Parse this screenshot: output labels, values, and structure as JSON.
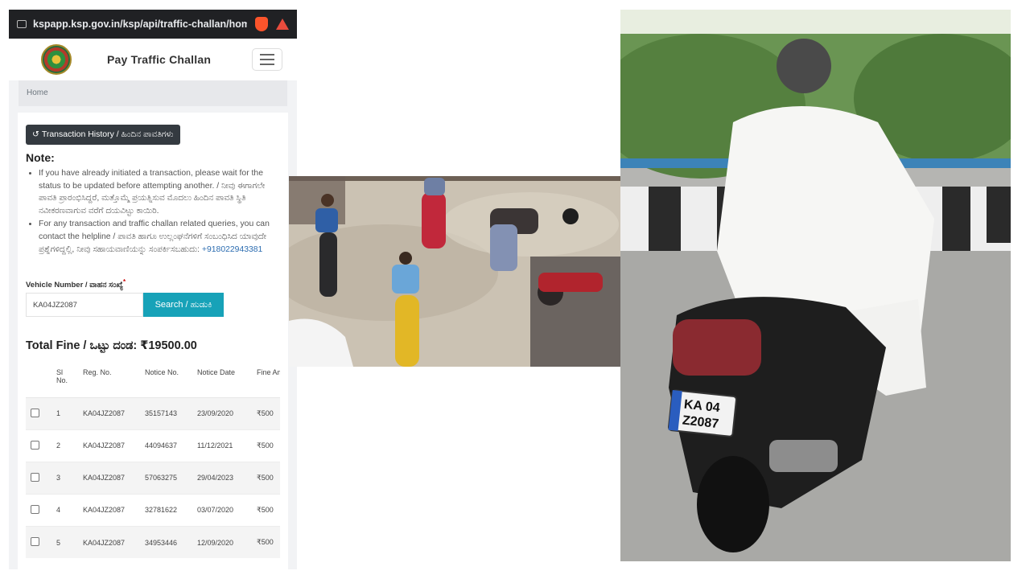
{
  "browser": {
    "url": "kspapp.ksp.gov.in/ksp/api/traffic-challan/hom"
  },
  "app": {
    "title": "Pay Traffic Challan",
    "breadcrumb": "Home"
  },
  "history_button": "Transaction History / ಹಿಂದಿನ ಪಾವತಿಗಳು",
  "note": {
    "title": "Note:",
    "items": [
      "If you have already initiated a transaction, please wait for the status to be updated before attempting another. / ನೀವು ಈಗಾಗಲೇ ಪಾವತಿ ಪ್ರಾರಂಭಿಸಿದ್ದರೆ, ಮತ್ತೊಮ್ಮೆ ಪ್ರಯತ್ನಿಸುವ ಮೊದಲು ಹಿಂದಿನ ಪಾವತಿ ಸ್ಥಿತಿ ನವೀಕರಣವಾಗುವ ವರೆಗೆ ದಯವಿಟ್ಟು ಕಾಯಿರಿ.",
      "For any transaction and traffic challan related queries, you can contact the helpline / ಪಾವತಿ ಹಾಗೂ ಉಲ್ಲಂಘನೆಗಳಿಗೆ ಸಂಬಂಧಿಸಿದ ಯಾವುದೇ ಪ್ರಶ್ನೆಗಳಿದ್ದಲ್ಲಿ, ನೀವು ಸಹಾಯವಾಣಿಯನ್ನು ಸಂಪರ್ಕಿಸಬಹುದು:"
    ],
    "helpline": "+918022943381"
  },
  "search": {
    "label": "Vehicle Number / ವಾಹನ ಸಂಖ್ಯೆ",
    "required_mark": "*",
    "value": "KA04JZ2087",
    "button": "Search / ಹುಡುಕಿ"
  },
  "total_fine": "Total Fine / ಒಟ್ಟು ದಂಡ: ₹19500.00",
  "table": {
    "headers": [
      "",
      "Sl No.",
      "Reg. No.",
      "Notice No.",
      "Notice Date",
      "Fine Amou"
    ],
    "rows": [
      [
        "1",
        "KA04JZ2087",
        "35157143",
        "23/09/2020",
        "₹500"
      ],
      [
        "2",
        "KA04JZ2087",
        "44094637",
        "11/12/2021",
        "₹500"
      ],
      [
        "3",
        "KA04JZ2087",
        "57063275",
        "29/04/2023",
        "₹500"
      ],
      [
        "4",
        "KA04JZ2087",
        "32781622",
        "03/07/2020",
        "₹500"
      ],
      [
        "5",
        "KA04JZ2087",
        "34953446",
        "12/09/2020",
        "₹500"
      ]
    ]
  },
  "photo_right": {
    "plate_line1": "KA 04",
    "plate_line2": "Z2087"
  },
  "colors": {
    "search_button": "#17a2b8",
    "history_button": "#343a40",
    "browser_bar": "#202124"
  },
  "icons": [
    "history-icon",
    "menu-icon",
    "brave-shield-icon",
    "site-settings-icon"
  ]
}
